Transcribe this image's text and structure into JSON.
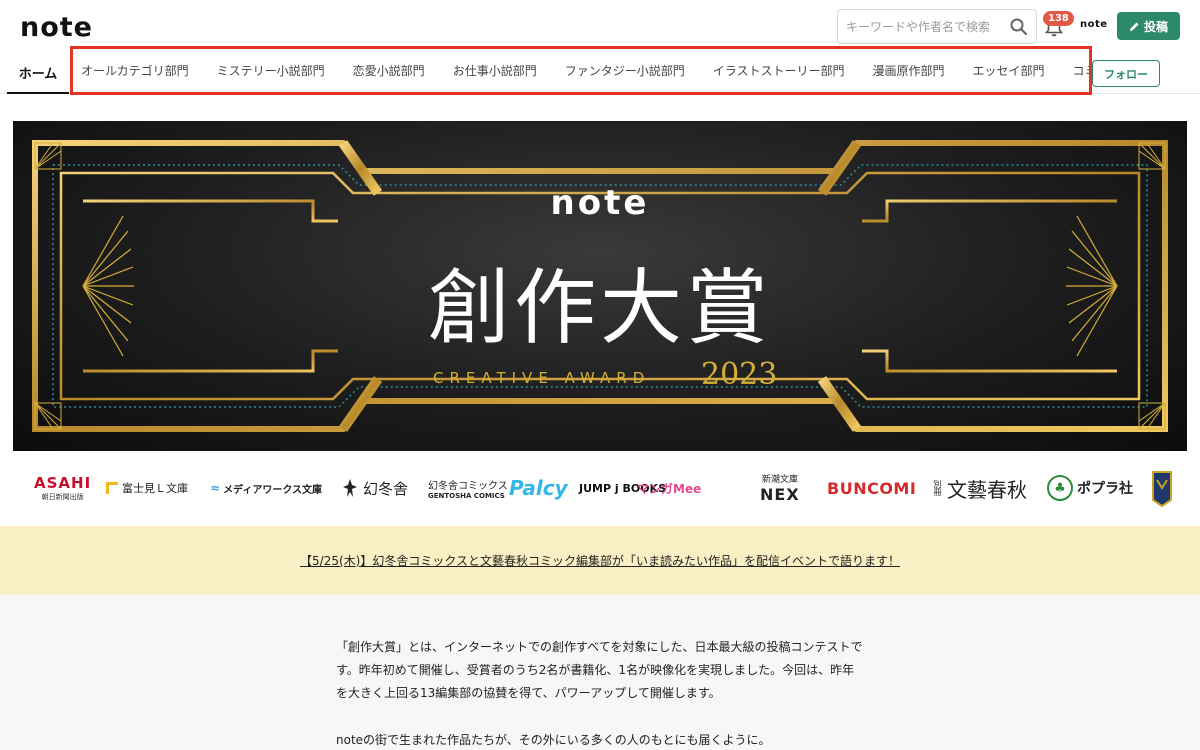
{
  "header": {
    "logo": "note",
    "search_placeholder": "キーワードや作者名で検索",
    "notification_count": "138",
    "mini_logo": "note",
    "post_label": "投稿"
  },
  "tabs": {
    "home": "ホーム",
    "categories": [
      "オールカテゴリ部門",
      "ミステリー小説部門",
      "恋愛小説部門",
      "お仕事小説部門",
      "ファンタジー小説部門",
      "イラストストーリー部門",
      "漫画原作部門",
      "エッセイ部門",
      "コミック"
    ],
    "follow_label": "フォロー"
  },
  "banner": {
    "logo": "note",
    "title": "創作大賞",
    "subtitle": "CREATIVE AWARD",
    "year": "2023"
  },
  "sponsors": {
    "asahi": "ASAHI",
    "asahi_sub": "朝日新聞出版",
    "fujimi": "富士見Ｌ文庫",
    "mediaworks": "メディアワークス文庫",
    "gentosha": "幻冬舎",
    "gentosha_comics": "幻冬舎コミックス",
    "gentosha_comics_en": "GENTOSHA COMICS",
    "palcy": "Palcy",
    "jump": "JUMP j BOOKS",
    "manga_mee": "マンガMee",
    "shincho": "新潮文庫",
    "shincho_nex": "NEX",
    "buncomi": "BUNCOMI",
    "bessatsu": "別冊",
    "bungei": "文藝春秋",
    "poplar": "ポプラ社"
  },
  "notice": {
    "text": "【5/25(木)】幻冬舎コミックスと文藝春秋コミック編集部が「いま読みたい作品」を配信イベントで語ります！"
  },
  "body": {
    "paragraph1": "「創作大賞」とは、インターネットでの創作すべてを対象にした、日本最大級の投稿コンテストです。昨年初めて開催し、受賞者のうち2名が書籍化、1名が映像化を実現しました。今回は、昨年を大きく上回る13編集部の協賛を得て、パワーアップして開催します。",
    "paragraph2": "noteの街で生まれた作品たちが、その外にいる多くの人のもとにも届くように。"
  },
  "colors": {
    "brand_green": "#2c8a69",
    "highlight_red": "#e43322",
    "gold": "#d4af37",
    "notice_bg": "#faefc4"
  }
}
